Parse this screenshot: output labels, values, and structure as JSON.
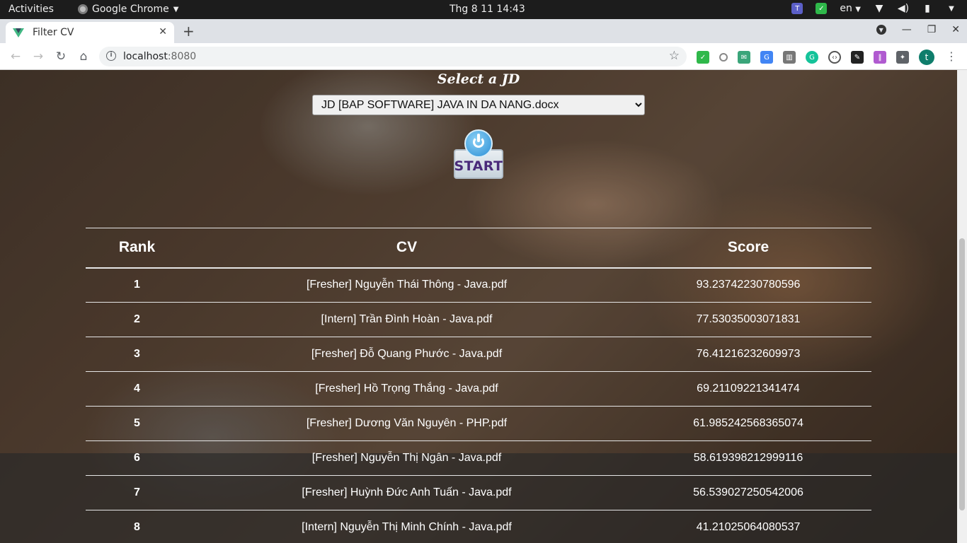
{
  "system": {
    "activities": "Activities",
    "app_name": "Google Chrome",
    "clock": "Thg 8 11  14:43",
    "lang": "en"
  },
  "browser": {
    "tab_title": "Filter CV",
    "url_host": "localhost",
    "url_port": ":8080",
    "profile_initial": "t"
  },
  "page": {
    "select_title": "Select a JD",
    "jd_selected": "JD [BAP SOFTWARE] JAVA IN DA NANG.docx",
    "start_label": "START",
    "table": {
      "headers": [
        "Rank",
        "CV",
        "Score"
      ],
      "rows": [
        {
          "rank": "1",
          "cv": "[Fresher] Nguyễn Thái Thông - Java.pdf",
          "score": "93.23742230780596"
        },
        {
          "rank": "2",
          "cv": "[Intern] Trần Đình Hoàn - Java.pdf",
          "score": "77.53035003071831"
        },
        {
          "rank": "3",
          "cv": "[Fresher] Đỗ Quang Phước - Java.pdf",
          "score": "76.41216232609973"
        },
        {
          "rank": "4",
          "cv": "[Fresher] Hồ Trọng Thắng - Java.pdf",
          "score": "69.21109221341474"
        },
        {
          "rank": "5",
          "cv": "[Fresher] Dương Văn Nguyên - PHP.pdf",
          "score": "61.985242568365074"
        },
        {
          "rank": "6",
          "cv": "[Fresher] Nguyễn Thị Ngân - Java.pdf",
          "score": "58.619398212999116"
        },
        {
          "rank": "7",
          "cv": "[Fresher] Huỳnh Đức Anh Tuấn - Java.pdf",
          "score": "56.539027250542006"
        },
        {
          "rank": "8",
          "cv": "[Intern] Nguyễn Thị Minh Chính - Java.pdf",
          "score": "41.21025064080537"
        }
      ]
    }
  }
}
